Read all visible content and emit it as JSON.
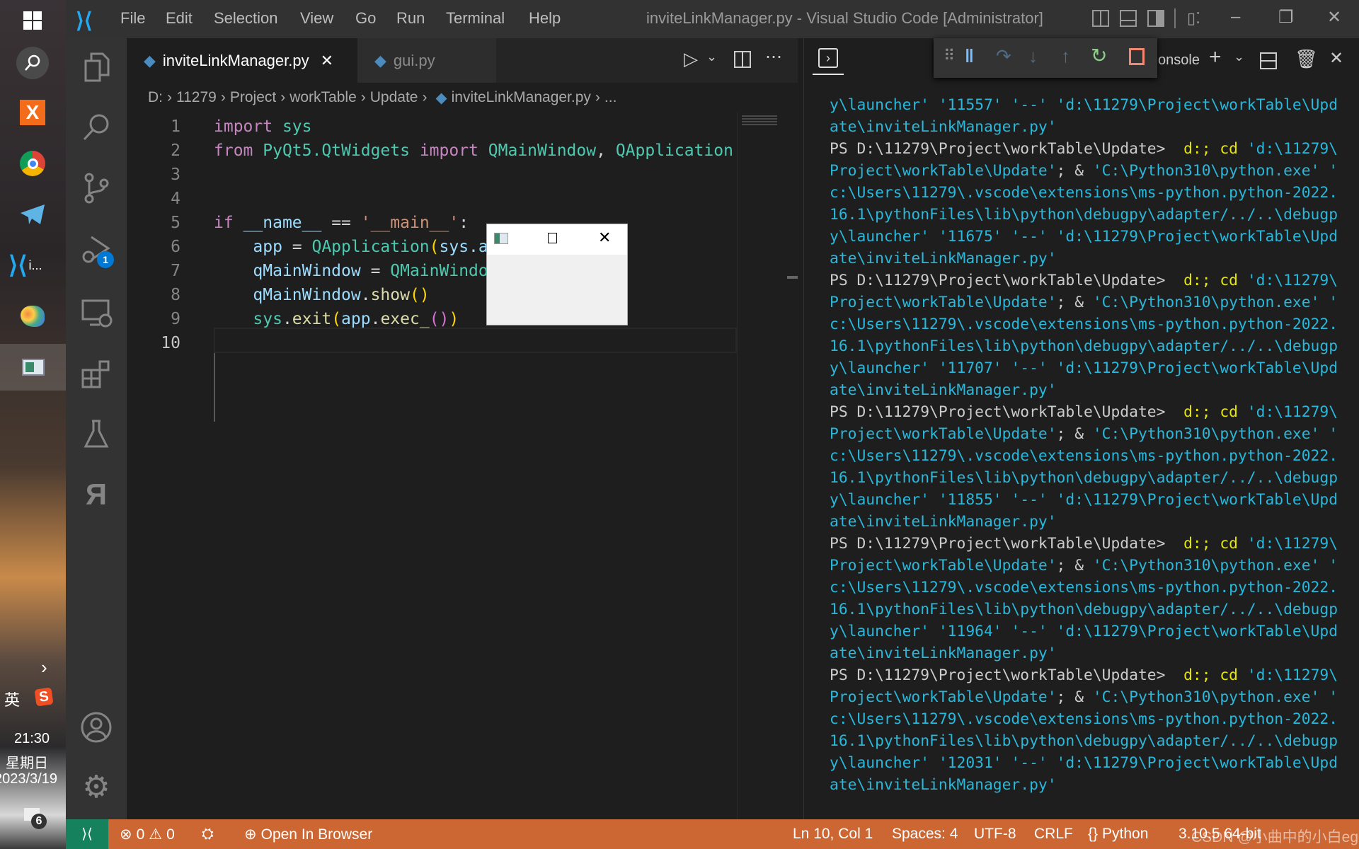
{
  "taskbar": {
    "apps": [
      "windows-start",
      "search",
      "xampp",
      "chrome",
      "telegram",
      "vscode",
      "paint",
      "qt-window"
    ],
    "vscode_label": "i...",
    "ime": "英",
    "time": "21:30",
    "weekday": "星期日",
    "date": "2023/3/19",
    "notifications": "6"
  },
  "titlebar": {
    "menu": [
      "File",
      "Edit",
      "Selection",
      "View",
      "Go",
      "Run",
      "Terminal",
      "Help"
    ],
    "title": "inviteLinkManager.py - Visual Studio Code [Administrator]"
  },
  "activity": {
    "debug_badge": "1"
  },
  "tabs": [
    {
      "label": "inviteLinkManager.py",
      "active": true
    },
    {
      "label": "gui.py",
      "active": false
    }
  ],
  "breadcrumb": [
    "D:",
    "11279",
    "Project",
    "workTable",
    "Update",
    "inviteLinkManager.py",
    "..."
  ],
  "editor": {
    "line_numbers": [
      "1",
      "2",
      "3",
      "4",
      "5",
      "6",
      "7",
      "8",
      "9",
      "10"
    ],
    "current_line": "10",
    "lines": [
      [
        [
          "kw",
          "import"
        ],
        [
          "op",
          " "
        ],
        [
          "cls",
          "sys"
        ]
      ],
      [
        [
          "kw",
          "from"
        ],
        [
          "op",
          " "
        ],
        [
          "cls",
          "PyQt5.QtWidgets"
        ],
        [
          "op",
          " "
        ],
        [
          "kw",
          "import"
        ],
        [
          "op",
          " "
        ],
        [
          "cls",
          "QMainWindow"
        ],
        [
          "op",
          ", "
        ],
        [
          "cls",
          "QApplication"
        ]
      ],
      [],
      [],
      [
        [
          "kw",
          "if"
        ],
        [
          "op",
          " "
        ],
        [
          "var",
          "__name__"
        ],
        [
          "op",
          " == "
        ],
        [
          "str",
          "'__main__'"
        ],
        [
          "op",
          ":"
        ]
      ],
      [
        [
          "op",
          "    "
        ],
        [
          "var",
          "app"
        ],
        [
          "op",
          " = "
        ],
        [
          "cls",
          "QApplication"
        ],
        [
          "br1",
          "("
        ],
        [
          "var",
          "sys.argv"
        ],
        [
          "br1",
          ")"
        ]
      ],
      [
        [
          "op",
          "    "
        ],
        [
          "var",
          "qMainWindow"
        ],
        [
          "op",
          " = "
        ],
        [
          "cls",
          "QMainWindow"
        ],
        [
          "br1",
          "()"
        ]
      ],
      [
        [
          "op",
          "    "
        ],
        [
          "var",
          "qMainWindow"
        ],
        [
          "op",
          "."
        ],
        [
          "fn",
          "show"
        ],
        [
          "br1",
          "()"
        ]
      ],
      [
        [
          "op",
          "    "
        ],
        [
          "cls",
          "sys"
        ],
        [
          "op",
          "."
        ],
        [
          "fn",
          "exit"
        ],
        [
          "br1",
          "("
        ],
        [
          "var",
          "app"
        ],
        [
          "op",
          "."
        ],
        [
          "fn",
          "exec_"
        ],
        [
          "br2",
          "()"
        ],
        [
          "br1",
          ")"
        ]
      ],
      []
    ]
  },
  "panel": {
    "tab_label_partial": "onsole"
  },
  "terminal": {
    "lines": [
      [
        [
          "c",
          "y\\launcher' '11557' '--' 'd:\\11279\\Project\\workTable\\Upd"
        ]
      ],
      [
        [
          "c",
          "ate\\inviteLinkManager.py'"
        ]
      ],
      [
        [
          "w",
          "PS D:\\11279\\Project\\workTable\\Update>  "
        ],
        [
          "y",
          "d:; cd "
        ],
        [
          "c",
          "'d:\\11279\\"
        ]
      ],
      [
        [
          "c",
          "Project\\workTable\\Update'"
        ],
        [
          "w",
          "; & "
        ],
        [
          "c",
          "'C:\\Python310\\python.exe' '"
        ]
      ],
      [
        [
          "c",
          "c:\\Users\\11279\\.vscode\\extensions\\ms-python.python-2022."
        ]
      ],
      [
        [
          "c",
          "16.1\\pythonFiles\\lib\\python\\debugpy\\adapter/../..\\debugp"
        ]
      ],
      [
        [
          "c",
          "y\\launcher' '11675' '--' 'd:\\11279\\Project\\workTable\\Upd"
        ]
      ],
      [
        [
          "c",
          "ate\\inviteLinkManager.py'"
        ]
      ],
      [
        [
          "w",
          "PS D:\\11279\\Project\\workTable\\Update>  "
        ],
        [
          "y",
          "d:; cd "
        ],
        [
          "c",
          "'d:\\11279\\"
        ]
      ],
      [
        [
          "c",
          "Project\\workTable\\Update'"
        ],
        [
          "w",
          "; & "
        ],
        [
          "c",
          "'C:\\Python310\\python.exe' '"
        ]
      ],
      [
        [
          "c",
          "c:\\Users\\11279\\.vscode\\extensions\\ms-python.python-2022."
        ]
      ],
      [
        [
          "c",
          "16.1\\pythonFiles\\lib\\python\\debugpy\\adapter/../..\\debugp"
        ]
      ],
      [
        [
          "c",
          "y\\launcher' '11707' '--' 'd:\\11279\\Project\\workTable\\Upd"
        ]
      ],
      [
        [
          "c",
          "ate\\inviteLinkManager.py'"
        ]
      ],
      [
        [
          "w",
          "PS D:\\11279\\Project\\workTable\\Update>  "
        ],
        [
          "y",
          "d:; cd "
        ],
        [
          "c",
          "'d:\\11279\\"
        ]
      ],
      [
        [
          "c",
          "Project\\workTable\\Update'"
        ],
        [
          "w",
          "; & "
        ],
        [
          "c",
          "'C:\\Python310\\python.exe' '"
        ]
      ],
      [
        [
          "c",
          "c:\\Users\\11279\\.vscode\\extensions\\ms-python.python-2022."
        ]
      ],
      [
        [
          "c",
          "16.1\\pythonFiles\\lib\\python\\debugpy\\adapter/../..\\debugp"
        ]
      ],
      [
        [
          "c",
          "y\\launcher' '11855' '--' 'd:\\11279\\Project\\workTable\\Upd"
        ]
      ],
      [
        [
          "c",
          "ate\\inviteLinkManager.py'"
        ]
      ],
      [
        [
          "w",
          "PS D:\\11279\\Project\\workTable\\Update>  "
        ],
        [
          "y",
          "d:; cd "
        ],
        [
          "c",
          "'d:\\11279\\"
        ]
      ],
      [
        [
          "c",
          "Project\\workTable\\Update'"
        ],
        [
          "w",
          "; & "
        ],
        [
          "c",
          "'C:\\Python310\\python.exe' '"
        ]
      ],
      [
        [
          "c",
          "c:\\Users\\11279\\.vscode\\extensions\\ms-python.python-2022."
        ]
      ],
      [
        [
          "c",
          "16.1\\pythonFiles\\lib\\python\\debugpy\\adapter/../..\\debugp"
        ]
      ],
      [
        [
          "c",
          "y\\launcher' '11964' '--' 'd:\\11279\\Project\\workTable\\Upd"
        ]
      ],
      [
        [
          "c",
          "ate\\inviteLinkManager.py'"
        ]
      ],
      [
        [
          "w",
          "PS D:\\11279\\Project\\workTable\\Update>  "
        ],
        [
          "y",
          "d:; cd "
        ],
        [
          "c",
          "'d:\\11279\\"
        ]
      ],
      [
        [
          "c",
          "Project\\workTable\\Update'"
        ],
        [
          "w",
          "; & "
        ],
        [
          "c",
          "'C:\\Python310\\python.exe' '"
        ]
      ],
      [
        [
          "c",
          "c:\\Users\\11279\\.vscode\\extensions\\ms-python.python-2022."
        ]
      ],
      [
        [
          "c",
          "16.1\\pythonFiles\\lib\\python\\debugpy\\adapter/../..\\debugp"
        ]
      ],
      [
        [
          "c",
          "y\\launcher' '12031' '--' 'd:\\11279\\Project\\workTable\\Upd"
        ]
      ],
      [
        [
          "c",
          "ate\\inviteLinkManager.py'"
        ]
      ]
    ]
  },
  "statusbar": {
    "errors": "0",
    "warnings": "0",
    "open_in_browser": "Open In Browser",
    "position": "Ln 10, Col 1",
    "spaces": "Spaces: 4",
    "encoding": "UTF-8",
    "eol": "CRLF",
    "language": "Python",
    "interpreter": "3.10.5 64-bit",
    "watermark": "CSDN @小曲中的小白egg",
    "colors": {
      "background": "#cc6633",
      "remote": "#16825d"
    }
  }
}
